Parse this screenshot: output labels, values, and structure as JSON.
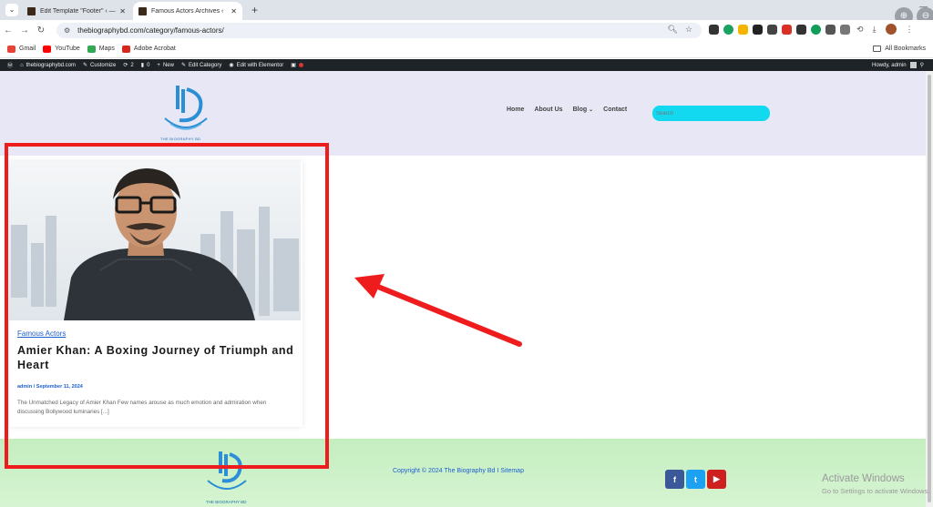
{
  "browser": {
    "tabs": [
      {
        "title": "Edit Template \"Footer\" ‹ — Wo",
        "close": "✕"
      },
      {
        "title": "Famous Actors Archives ‹",
        "close": "✕"
      }
    ],
    "new_tab": "+",
    "url": "thebiographybd.com/category/famous-actors/",
    "bookmarks": [
      "Gmail",
      "YouTube",
      "Maps",
      "Adobe Acrobat"
    ],
    "all_bookmarks": "All Bookmarks"
  },
  "admin_bar": {
    "site": "thebiographybd.com",
    "customize": "Customize",
    "updates": "2",
    "comments": "0",
    "new": "New",
    "edit_category": "Edit Category",
    "elementor": "Edit with Elementor",
    "howdy": "Howdy, admin"
  },
  "header": {
    "logo_text": "THE BIOGRAPHY BD",
    "nav": [
      "Home",
      "About Us",
      "Blog",
      "Contact"
    ],
    "search_placeholder": "Search"
  },
  "post": {
    "category": "Famous Actors",
    "title": "Amier Khan: A Boxing Journey of Triumph and Heart",
    "meta": "admin / September 11, 2024",
    "excerpt": "The Unmatched Legacy of Amier Khan   Few names arouse as much emotion and admiration when discussing Bollywood luminaries [...]"
  },
  "footer": {
    "logo_text": "THE BIOGRAPHY BD",
    "copyright": "Copyright ©  2024 The Biography Bd I",
    "sitemap": "Sitemap"
  },
  "windows_watermark": {
    "line1": "Activate Windows",
    "line2": "Go to Settings to activate Windows."
  },
  "colors": {
    "header_bg": "#e8e7f5",
    "search_bg": "#12d8f0",
    "footer_bg": "#c4eec0",
    "annotation_red": "#ee1c1c",
    "link_blue": "#1c5fcf"
  }
}
